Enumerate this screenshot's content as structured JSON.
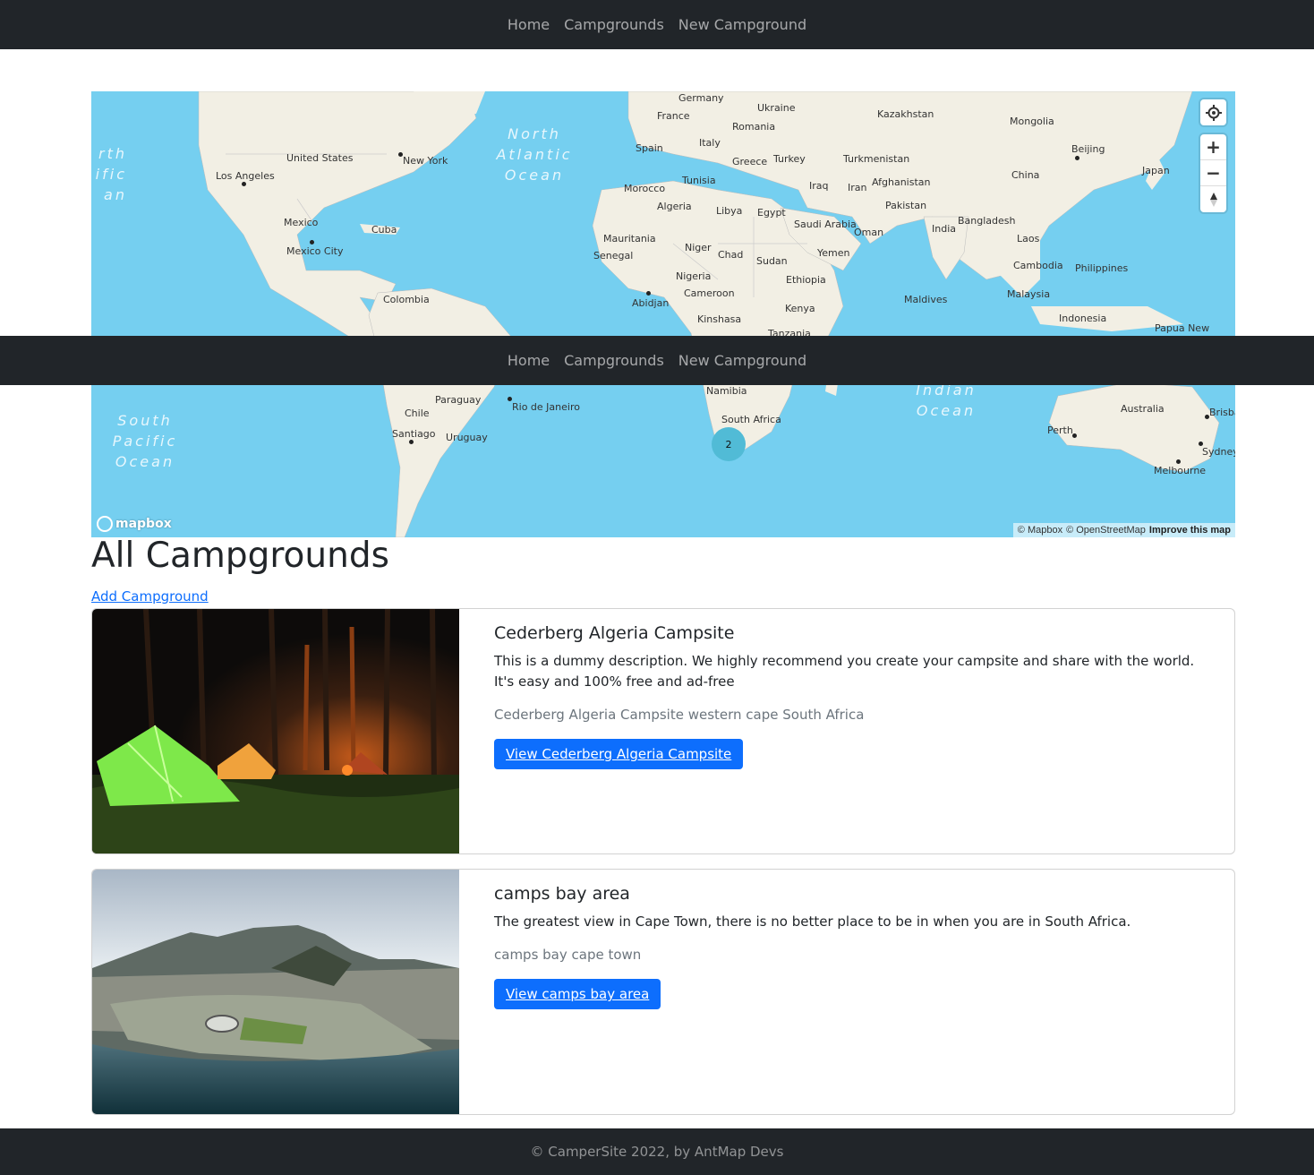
{
  "nav": {
    "home": "Home",
    "campgrounds": "Campgrounds",
    "new_campground": "New Campground"
  },
  "map": {
    "labels": {
      "germany": "Germany",
      "ukraine": "Ukraine",
      "kazakhstan": "Kazakhstan",
      "mongolia": "Mongolia",
      "france": "France",
      "romania": "Romania",
      "italy": "Italy",
      "spain": "Spain",
      "greece": "Greece",
      "turkey": "Turkey",
      "turkmenistan": "Turkmenistan",
      "beijing": "Beijing",
      "china": "China",
      "japan": "Japan",
      "united_states": "United States",
      "new_york": "New York",
      "los_angeles": "Los Angeles",
      "morocco": "Morocco",
      "tunisia": "Tunisia",
      "iraq": "Iraq",
      "iran": "Iran",
      "afghanistan": "Afghanistan",
      "algeria": "Algeria",
      "libya": "Libya",
      "egypt": "Egypt",
      "pakistan": "Pakistan",
      "mexico": "Mexico",
      "cuba": "Cuba",
      "saudi_arabia": "Saudi Arabia",
      "oman": "Oman",
      "india": "India",
      "bangladesh": "Bangladesh",
      "mexico_city": "Mexico City",
      "mauritania": "Mauritania",
      "niger": "Niger",
      "laos": "Laos",
      "senegal": "Senegal",
      "chad": "Chad",
      "sudan": "Sudan",
      "yemen": "Yemen",
      "cambodia": "Cambodia",
      "philippines": "Philippines",
      "nigeria": "Nigeria",
      "ethiopia": "Ethiopia",
      "colombia": "Colombia",
      "cameroon": "Cameroon",
      "maldives": "Maldives",
      "malaysia": "Malaysia",
      "abidjan": "Abidjan",
      "kenya": "Kenya",
      "kinshasa": "Kinshasa",
      "indonesia": "Indonesia",
      "papua_new": "Papua New",
      "tanzania": "Tanzania",
      "paraguay": "Paraguay",
      "namibia": "Namibia",
      "rio": "Rio de Janeiro",
      "chile": "Chile",
      "south_africa": "South Africa",
      "australia": "Australia",
      "santiago": "Santiago",
      "uruguay": "Uruguay",
      "perth": "Perth",
      "brisbane": "Brisba",
      "sydney": "Sydney",
      "melbourne": "Melbourne"
    },
    "oceans": {
      "north_atlantic": "North\nAtlantic\nOcean",
      "north_pacific": "rth\nific\nan",
      "south_pacific": "South\nPacific\nOcean",
      "indian": "Indian\nOcean"
    },
    "cluster_count": "2",
    "logo": "mapbox",
    "attribution": {
      "mapbox": "© Mapbox",
      "osm": "© OpenStreetMap",
      "improve": "Improve this map"
    },
    "controls": {
      "zoom_in": "+",
      "zoom_out": "−"
    }
  },
  "page": {
    "title": "All Campgrounds",
    "add_link": "Add Campground"
  },
  "campgrounds": [
    {
      "title": "Cederberg Algeria Campsite",
      "description": "This is a dummy description. We highly recommend you create your campsite and share with the world. It's easy and 100% free and ad-free",
      "location": "Cederberg Algeria Campsite western cape South Africa",
      "button": "View Cederberg Algeria Campsite"
    },
    {
      "title": "camps bay area",
      "description": "The greatest view in Cape Town, there is no better place to be in when you are in South Africa.",
      "location": "camps bay cape town",
      "button": "View camps bay area"
    }
  ],
  "footer": {
    "text": "© CamperSite 2022, by AntMap Devs"
  }
}
